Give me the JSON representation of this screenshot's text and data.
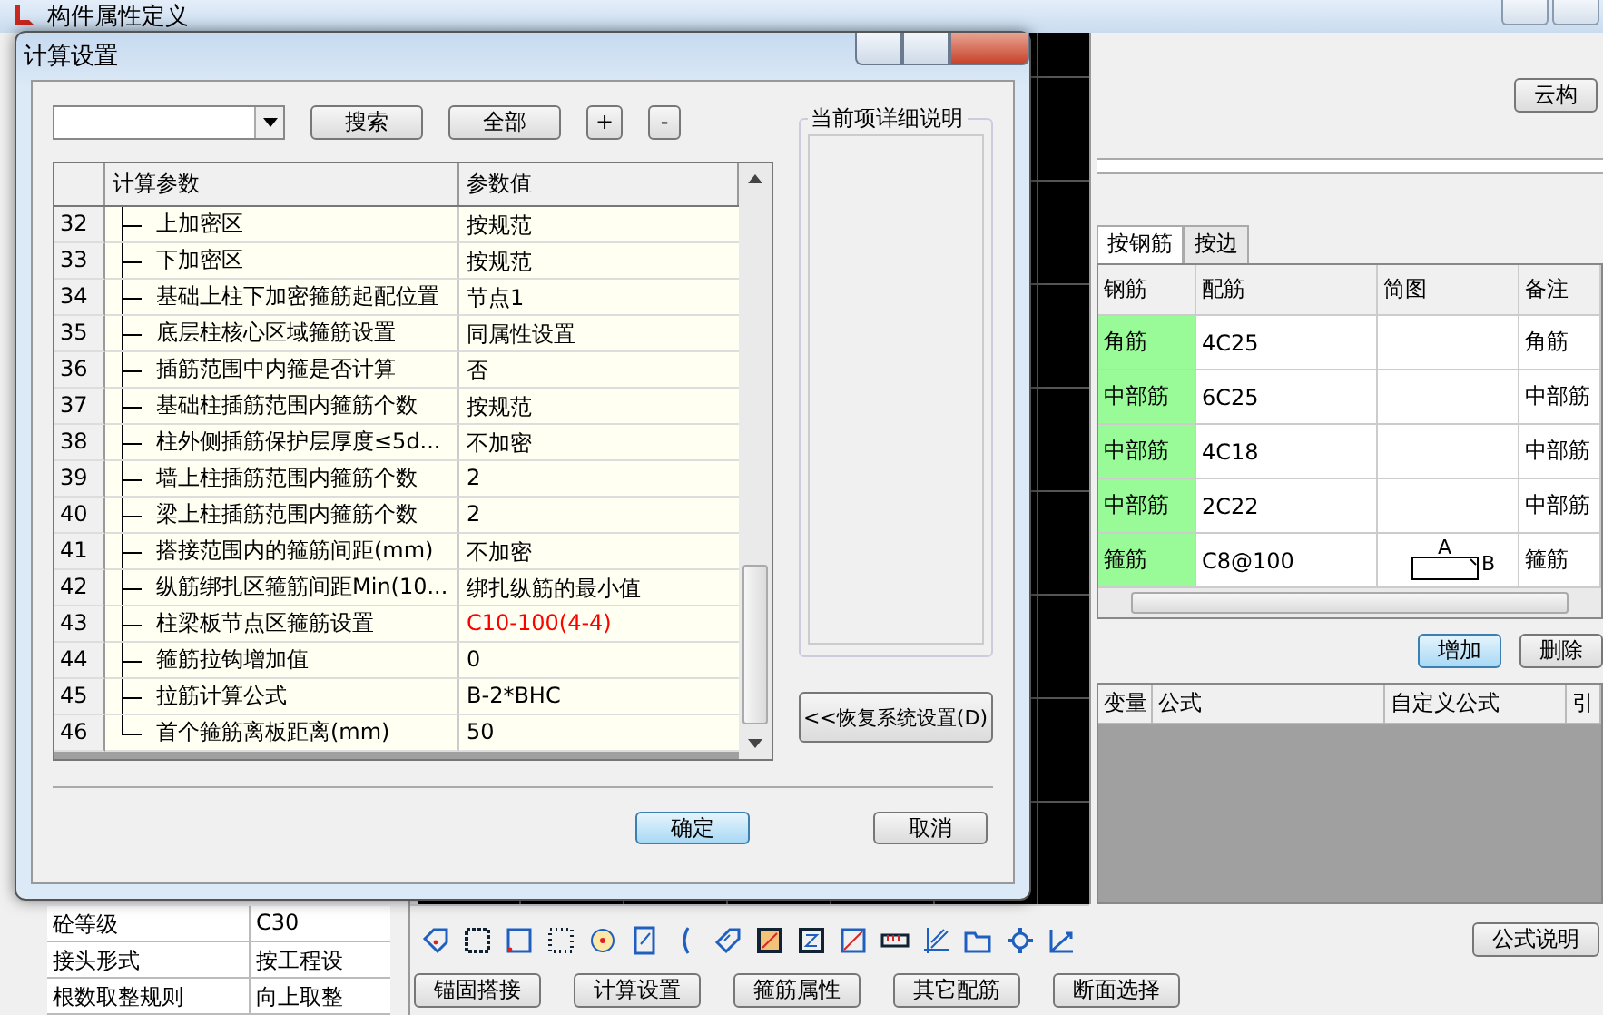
{
  "window": {
    "title": "构件属性定义"
  },
  "properties": [
    {
      "label": "砼等级",
      "value": "C30"
    },
    {
      "label": "接头形式",
      "value": "按工程设"
    },
    {
      "label": "根数取整规则",
      "value": "向上取整"
    }
  ],
  "right_panel": {
    "cloud_button": "云构",
    "tabs": [
      {
        "label": "按钢筋",
        "selected": true
      },
      {
        "label": "按边",
        "selected": false
      }
    ],
    "rebar_table": {
      "columns": [
        "钢筋",
        "配筋",
        "简图",
        "备注"
      ],
      "rows": [
        {
          "rebar": "角筋",
          "spec": "4C25",
          "note": "角筋"
        },
        {
          "rebar": "中部筋",
          "spec": "6C25",
          "note": "中部筋"
        },
        {
          "rebar": "中部筋",
          "spec": "4C18",
          "note": "中部筋"
        },
        {
          "rebar": "中部筋",
          "spec": "2C22",
          "note": "中部筋"
        },
        {
          "rebar": "箍筋",
          "spec": "C8@100",
          "diagram": {
            "top": "A",
            "side": "B"
          },
          "note": "箍筋"
        }
      ]
    },
    "buttons": [
      {
        "label": "增加",
        "default": true
      },
      {
        "label": "删除",
        "default": false
      }
    ],
    "formula_table": {
      "columns": [
        "变量",
        "公式",
        "自定义公式",
        "引"
      ]
    },
    "formula_help_button": "公式说明"
  },
  "bottom_buttons": [
    "锚固搭接",
    "计算设置",
    "箍筋属性",
    "其它配筋",
    "断面选择"
  ],
  "dialog": {
    "title": "计算设置",
    "search_button": "搜索",
    "all_button": "全部",
    "expand_button": "+",
    "collapse_button": "-",
    "grid": {
      "columns": [
        "计算参数",
        "参数值"
      ],
      "rows": [
        {
          "number": "32",
          "name": "上加密区",
          "value": "按规范",
          "color": "#000000"
        },
        {
          "number": "33",
          "name": "下加密区",
          "value": "按规范",
          "color": "#000000"
        },
        {
          "number": "34",
          "name": "基础上柱下加密箍筋起配位置",
          "value": "节点1",
          "color": "#000000"
        },
        {
          "number": "35",
          "name": "底层柱核心区域箍筋设置",
          "value": "同属性设置",
          "color": "#000000"
        },
        {
          "number": "36",
          "name": "插筋范围中内箍是否计算",
          "value": "否",
          "color": "#000000"
        },
        {
          "number": "37",
          "name": "基础柱插筋范围内箍筋个数",
          "value": "按规范",
          "color": "#000000"
        },
        {
          "number": "38",
          "name": "柱外侧插筋保护层厚度≤5d...",
          "value": "不加密",
          "color": "#000000"
        },
        {
          "number": "39",
          "name": "墙上柱插筋范围内箍筋个数",
          "value": "2",
          "color": "#000000"
        },
        {
          "number": "40",
          "name": "梁上柱插筋范围内箍筋个数",
          "value": "2",
          "color": "#000000"
        },
        {
          "number": "41",
          "name": "搭接范围内的箍筋间距(mm)",
          "value": "不加密",
          "color": "#000000"
        },
        {
          "number": "42",
          "name": "纵筋绑扎区箍筋间距Min(10...",
          "value": "绑扎纵筋的最小值",
          "color": "#000000"
        },
        {
          "number": "43",
          "name": "柱梁板节点区箍筋设置",
          "value": "C10-100(4-4)",
          "color": "#ff0000"
        },
        {
          "number": "44",
          "name": "箍筋拉钩增加值",
          "value": "0",
          "color": "#000000"
        },
        {
          "number": "45",
          "name": "拉筋计算公式",
          "value": "B-2*BHC",
          "color": "#000000"
        },
        {
          "number": "46",
          "name": "首个箍筋离板距离(mm)",
          "value": "50",
          "color": "#000000"
        }
      ]
    },
    "description_title": "当前项详细说明",
    "restore_button": "<<恢复系统设置(D)",
    "ok_button": "确定",
    "cancel_button": "取消"
  }
}
